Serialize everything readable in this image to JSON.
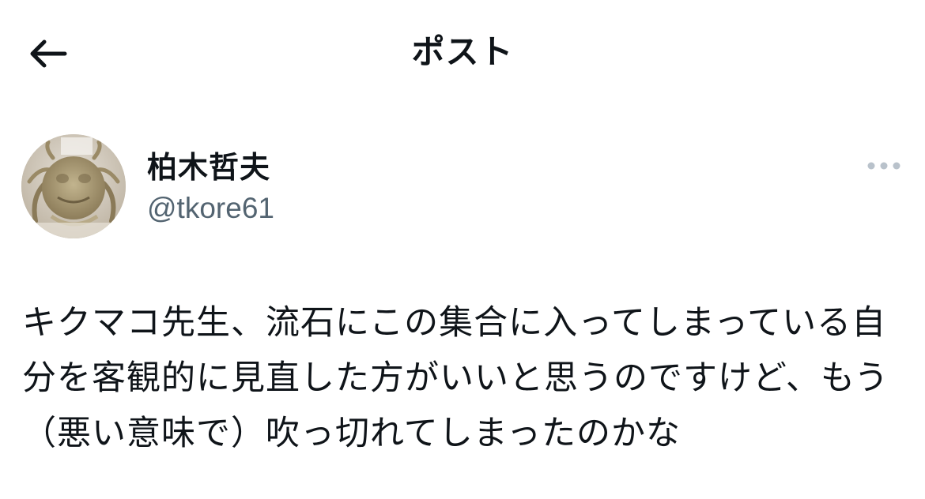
{
  "header": {
    "title": "ポスト",
    "back_icon": "arrow-left-icon"
  },
  "author": {
    "display_name": "柏木哲夫",
    "handle": "@tkore61",
    "avatar": "crab-photo-avatar"
  },
  "more_icon": "more-horizontal-icon",
  "post": {
    "text": "キクマコ先生、流石にこの集合に入ってしまっている自分を客観的に見直した方がいいと思うのですけど、もう（悪い意味で）吹っ切れてしまったのかな"
  },
  "colors": {
    "text_primary": "#0f1419",
    "text_secondary": "#536471",
    "background": "#ffffff"
  }
}
